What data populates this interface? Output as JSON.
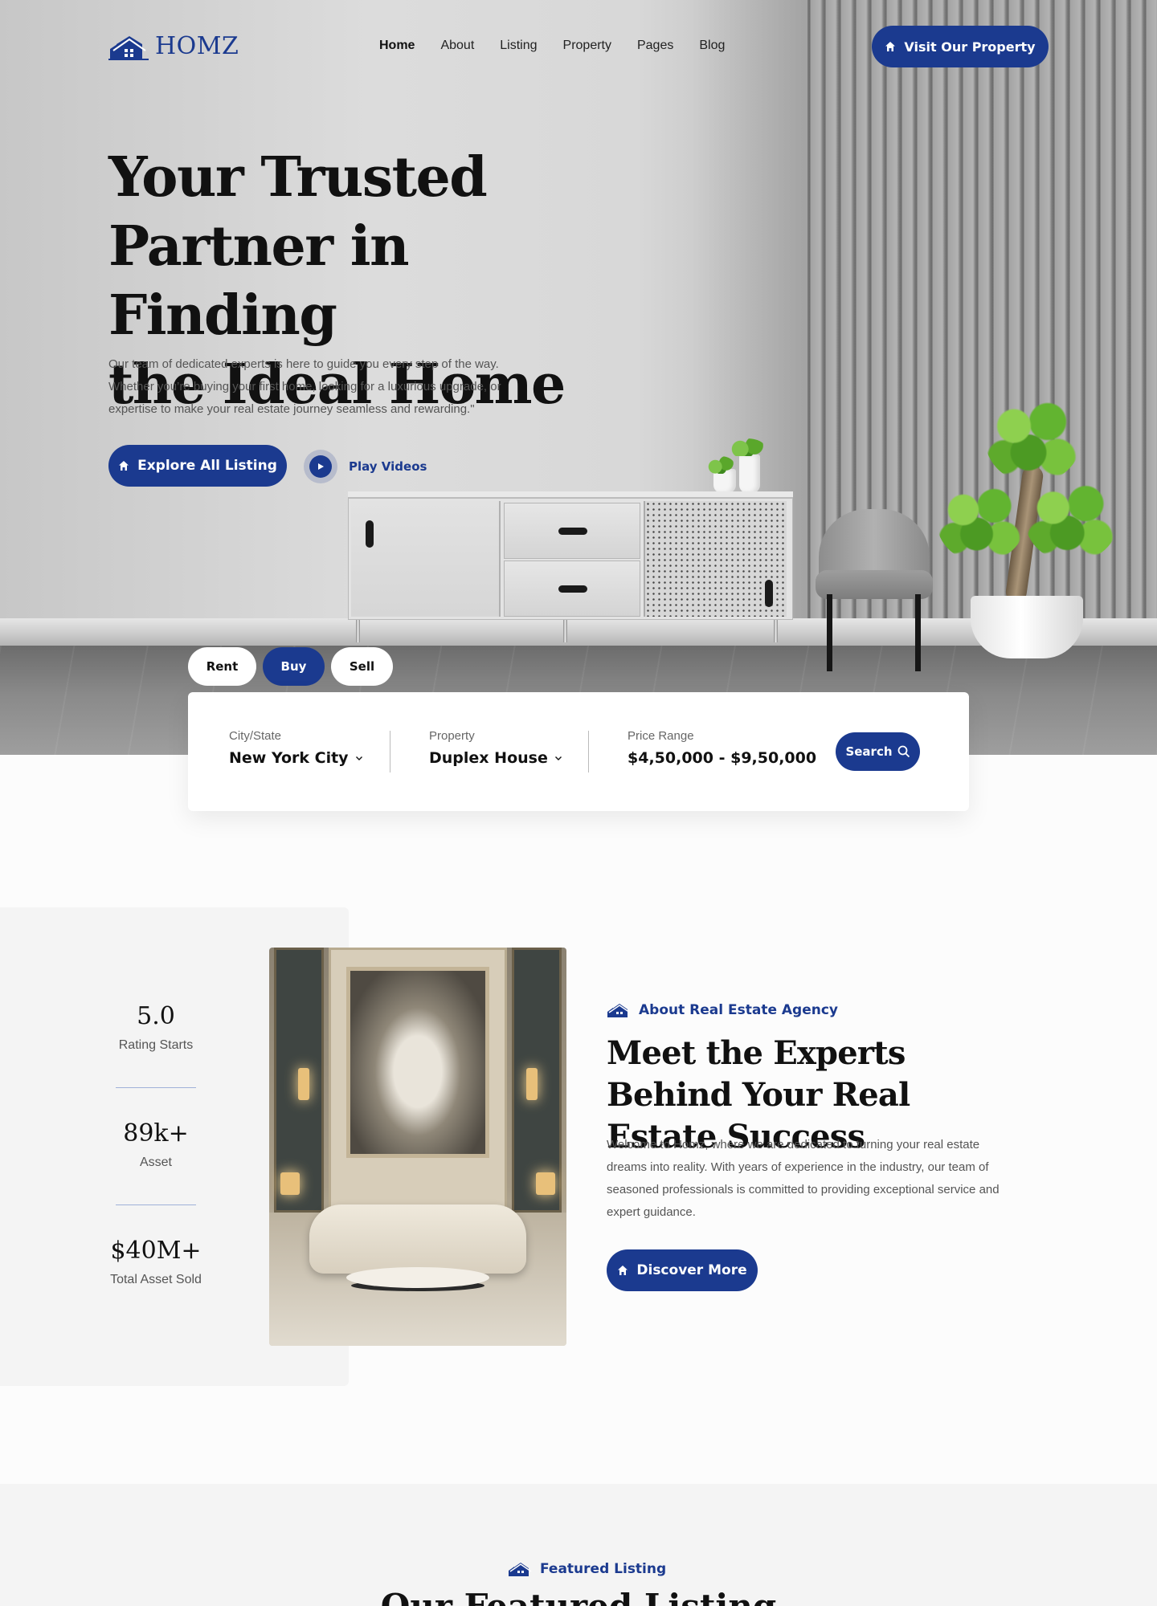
{
  "brand": {
    "name": "HOMZ",
    "logo_icon": "house-logo-icon",
    "accent_color": "#1b3a8f"
  },
  "nav": {
    "items": [
      {
        "label": "Home",
        "active": true
      },
      {
        "label": "About",
        "active": false
      },
      {
        "label": "Listing",
        "active": false
      },
      {
        "label": "Property",
        "active": false
      },
      {
        "label": "Pages",
        "active": false
      },
      {
        "label": "Blog",
        "active": false
      }
    ],
    "cta_label": "Visit Our Property",
    "cta_icon": "home-icon"
  },
  "hero": {
    "title_lines": [
      "Your Trusted",
      "Partner in Finding",
      "the Ideal Home"
    ],
    "description": "Our team of dedicated experts is here to guide you every step of the way. Whether you’re buying your first home, looking for a luxurious upgrade, or expertise to make your real estate journey seamless and rewarding.\"",
    "explore_label": "Explore All Listing",
    "play_label": "Play Videos"
  },
  "search": {
    "tabs": [
      {
        "label": "Rent",
        "active": false
      },
      {
        "label": "Buy",
        "active": true
      },
      {
        "label": "Sell",
        "active": false
      }
    ],
    "city": {
      "label": "City/State",
      "value": "New York City"
    },
    "property": {
      "label": "Property",
      "value": "Duplex House"
    },
    "price": {
      "label": "Price Range",
      "value": "$4,50,000 - $9,50,000"
    },
    "button_label": "Search",
    "button_icon": "search-icon"
  },
  "stats": [
    {
      "value": "5.0",
      "caption": "Rating Starts"
    },
    {
      "value": "89k+",
      "caption": "Asset"
    },
    {
      "value": "$40M+",
      "caption": "Total Asset Sold"
    }
  ],
  "about": {
    "eyebrow": "About Real Estate Agency",
    "title": "Meet the Experts Behind Your Real Estate Success",
    "text": "Welcome to Homz, where we are dedicated to turning your real estate dreams into reality. With years of experience in the industry, our team of seasoned professionals is committed to providing exceptional service and expert guidance.",
    "button_label": "Discover More"
  },
  "featured": {
    "eyebrow": "Featured Listing",
    "title": "Our Featured Listing"
  }
}
